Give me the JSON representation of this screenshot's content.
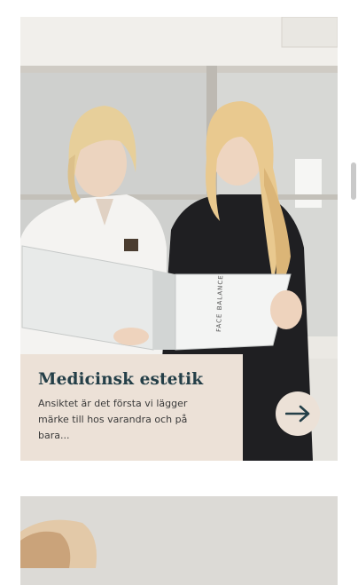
{
  "cards": [
    {
      "title": "Medicinsk estetik",
      "description": "Ansiktet är det första vi lägger märke till hos varandra och på bara...",
      "image_alt": "two-women-reading-folder",
      "folder_print": "FACE BALANCE",
      "action_icon": "arrow-right-icon"
    },
    {
      "image_alt": "woman-portrait"
    }
  ],
  "colors": {
    "caption_bg": "#ece1d7",
    "title": "#243f48",
    "arrow": "#243f48"
  }
}
